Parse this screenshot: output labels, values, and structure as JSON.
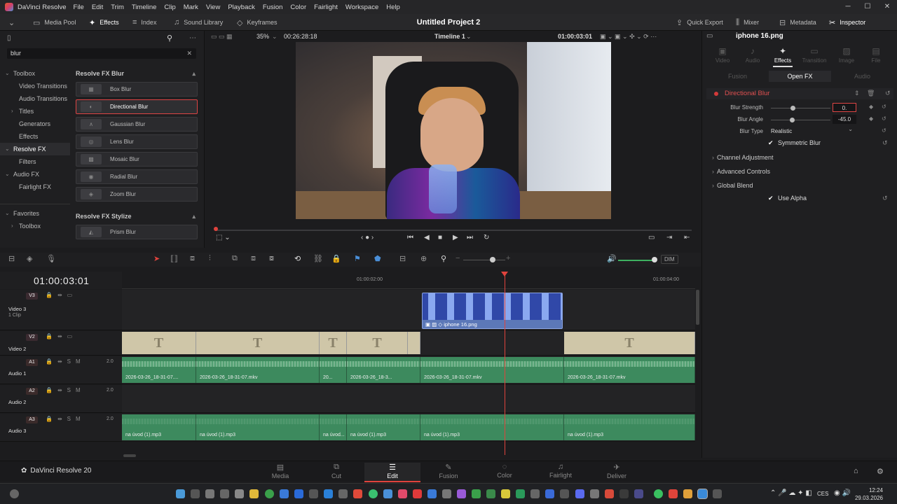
{
  "app": {
    "name": "DaVinci Resolve",
    "project_title": "Untitled Project 2",
    "menu": [
      "File",
      "Edit",
      "Trim",
      "Timeline",
      "Clip",
      "Mark",
      "View",
      "Playback",
      "Fusion",
      "Color",
      "Fairlight",
      "Workspace",
      "Help"
    ]
  },
  "toolbar": {
    "left": [
      {
        "icon": "media-pool-icon",
        "label": "Media Pool"
      },
      {
        "icon": "effects-icon",
        "label": "Effects"
      },
      {
        "icon": "index-icon",
        "label": "Index"
      },
      {
        "icon": "sound-library-icon",
        "label": "Sound Library"
      },
      {
        "icon": "keyframes-icon",
        "label": "Keyframes"
      }
    ],
    "right": [
      {
        "icon": "quick-export-icon",
        "label": "Quick Export"
      },
      {
        "icon": "mixer-icon",
        "label": "Mixer"
      },
      {
        "icon": "metadata-icon",
        "label": "Metadata"
      },
      {
        "icon": "inspector-icon",
        "label": "Inspector"
      }
    ]
  },
  "effects_panel": {
    "search_value": "blur",
    "tree": [
      {
        "label": "Toolbox",
        "level": 0,
        "expanded": true
      },
      {
        "label": "Video Transitions",
        "level": 1
      },
      {
        "label": "Audio Transitions",
        "level": 1
      },
      {
        "label": "Titles",
        "level": 1,
        "collapsed": true
      },
      {
        "label": "Generators",
        "level": 1
      },
      {
        "label": "Effects",
        "level": 1
      },
      {
        "label": "Resolve FX",
        "level": 0,
        "selected": true
      },
      {
        "label": "Filters",
        "level": 1
      },
      {
        "label": "Audio FX",
        "level": 0,
        "expanded": true
      },
      {
        "label": "Fairlight FX",
        "level": 1
      }
    ],
    "favorites": {
      "label": "Favorites",
      "child": "Toolbox"
    },
    "groups": [
      {
        "title": "Resolve FX Blur",
        "items": [
          "Box Blur",
          "Directional Blur",
          "Gaussian Blur",
          "Lens Blur",
          "Mosaic Blur",
          "Radial Blur",
          "Zoom Blur"
        ],
        "selected": "Directional Blur"
      },
      {
        "title": "Resolve FX Stylize",
        "items": [
          "Prism Blur"
        ]
      }
    ]
  },
  "viewer": {
    "zoom": "35%",
    "source_timecode": "00:26:28:18",
    "timeline_name": "Timeline 1",
    "record_timecode": "01:00:03:01"
  },
  "inspector": {
    "clip_name": "iphone 16.png",
    "tabs": [
      "Video",
      "Audio",
      "Effects",
      "Transition",
      "Image",
      "File"
    ],
    "active_tab": "Effects",
    "subtabs": [
      "Fusion",
      "Open FX",
      "Audio"
    ],
    "active_subtab": "Open FX",
    "effect_name": "Directional Blur",
    "params": {
      "blur_strength": {
        "label": "Blur Strength",
        "value": "0.",
        "slider": 0.37
      },
      "blur_angle": {
        "label": "Blur Angle",
        "value": "-45.0",
        "slider": 0.35
      },
      "blur_type": {
        "label": "Blur Type",
        "value": "Realistic"
      }
    },
    "symmetric_blur": "Symmetric Blur",
    "sections": [
      "Channel Adjustment",
      "Advanced Controls",
      "Global Blend"
    ],
    "use_alpha": "Use Alpha"
  },
  "timeline": {
    "timecode": "01:00:03:01",
    "ruler": [
      "01:00:02:00",
      "01:00:04:00"
    ],
    "tracks": [
      {
        "tag": "V3",
        "name": "Video 3",
        "sub": "1 Clip"
      },
      {
        "tag": "V2",
        "name": "Video 2",
        "sub": ""
      },
      {
        "tag": "A1",
        "name": "Audio 1",
        "level": "2.0"
      },
      {
        "tag": "A2",
        "name": "Audio 2",
        "level": "2.0"
      },
      {
        "tag": "A3",
        "name": "Audio 3",
        "level": "2.0"
      }
    ],
    "v3_clip": "iphone 16.png",
    "a1_clips": [
      "2026-03-26_18-31-07....",
      "2026-03-26_18-31-07.mkv",
      "20...",
      "2026-03-26_18-3...",
      "2026-03-26_18-31-07.mkv",
      "2026-03-26_18-31-07.mkv"
    ],
    "a3_clips": [
      "na úvod (1).mp3",
      "na úvod (1).mp3",
      "na úvod...",
      "na úvod (1).mp3",
      "na úvod (1).mp3",
      "na úvod (1).mp3"
    ],
    "dim_label": "DIM"
  },
  "pages": {
    "brand": "DaVinci Resolve 20",
    "items": [
      "Media",
      "Cut",
      "Edit",
      "Fusion",
      "Color",
      "Fairlight",
      "Deliver"
    ],
    "active": "Edit"
  },
  "taskbar": {
    "lang": "CES",
    "time": "12:24",
    "date": "29.03.2026"
  }
}
